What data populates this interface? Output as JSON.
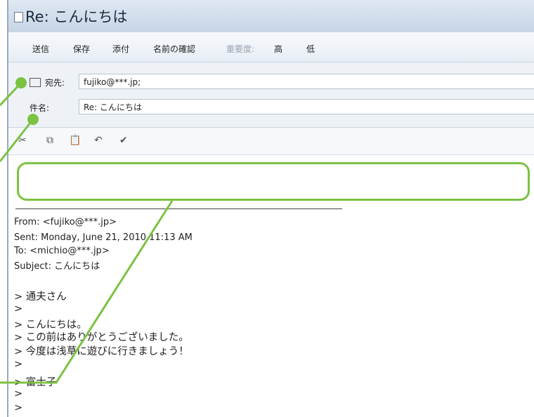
{
  "window": {
    "title": "Re: こんにちは"
  },
  "toolbar": {
    "send": "送信",
    "save": "保存",
    "attach": "添付",
    "check_names": "名前の確認",
    "importance_label": "重要度:",
    "high": "高",
    "low": "低"
  },
  "fields": {
    "to_label": "宛先:",
    "to_value": "fujiko@***.jp;",
    "subject_label": "件名:",
    "subject_value": "Re: こんにちは"
  },
  "quoted": {
    "separator": "------------------------------------------------------------------",
    "from": "From: <fujiko@***.jp>",
    "sent": "Sent: Monday, June 21, 2010 11:13 AM",
    "to": "To: <michio@***.jp>",
    "subject": "Subject: こんにちは",
    "lines": [
      "> 通夫さん",
      ">",
      "> こんにちは。",
      "> この前はありがとうございました。",
      "> 今度は浅草に遊びに行きましょう！",
      ">",
      "> 富士子",
      ">",
      ">"
    ]
  },
  "colors": {
    "accent": "#7cc242"
  }
}
